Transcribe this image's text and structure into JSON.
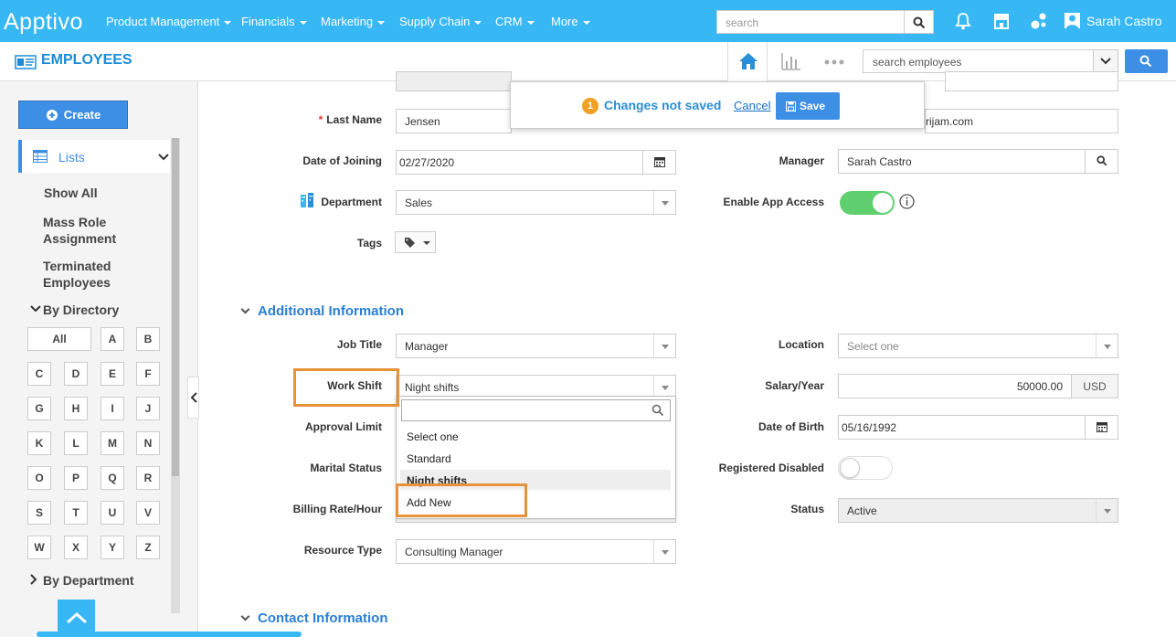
{
  "topnav": {
    "logo": "Apptivo",
    "menus": [
      "Product Management",
      "Financials",
      "Marketing",
      "Supply Chain",
      "CRM",
      "More"
    ],
    "search_placeholder": "search",
    "user": "Sarah Castro"
  },
  "subbar": {
    "title": "EMPLOYEES",
    "search_placeholder": "search employees"
  },
  "sidebar": {
    "create": "Create",
    "lists": "Lists",
    "items": [
      "Show All",
      "Mass Role Assignment",
      "Terminated Employees"
    ],
    "by_directory": "By Directory",
    "letters": [
      "All",
      "A",
      "B",
      "C",
      "D",
      "E",
      "F",
      "G",
      "H",
      "I",
      "J",
      "K",
      "L",
      "M",
      "N",
      "O",
      "P",
      "Q",
      "R",
      "S",
      "T",
      "U",
      "V",
      "W",
      "X",
      "Y",
      "Z"
    ],
    "by_department": "By Department"
  },
  "notice": {
    "count": "1",
    "message": "Changes not saved",
    "cancel": "Cancel",
    "save": "Save"
  },
  "form": {
    "last_name_label": "Last Name",
    "last_name": "Jensen",
    "email_partial": "rijam.com",
    "doj_label": "Date of Joining",
    "doj": "02/27/2020",
    "manager_label": "Manager",
    "manager": "Sarah Castro",
    "department_label": "Department",
    "department": "Sales",
    "app_access_label": "Enable App Access",
    "app_access": true,
    "tags_label": "Tags"
  },
  "additional": {
    "title": "Additional Information",
    "job_title_label": "Job Title",
    "job_title": "Manager",
    "location_label": "Location",
    "location_placeholder": "Select one",
    "work_shift_label": "Work Shift",
    "work_shift": "Night shifts",
    "salary_label": "Salary/Year",
    "salary": "50000.00",
    "currency": "USD",
    "approval_label": "Approval Limit",
    "dob_label": "Date of Birth",
    "dob": "05/16/1992",
    "marital_label": "Marital Status",
    "registered_label": "Registered Disabled",
    "registered": false,
    "billing_label": "Billing Rate/Hour",
    "status_label": "Status",
    "status": "Active",
    "resource_label": "Resource Type",
    "resource": "Consulting Manager",
    "shift_options": [
      "Select one",
      "Standard",
      "Night shifts",
      "Add New"
    ]
  },
  "contact": {
    "title": "Contact Information"
  }
}
